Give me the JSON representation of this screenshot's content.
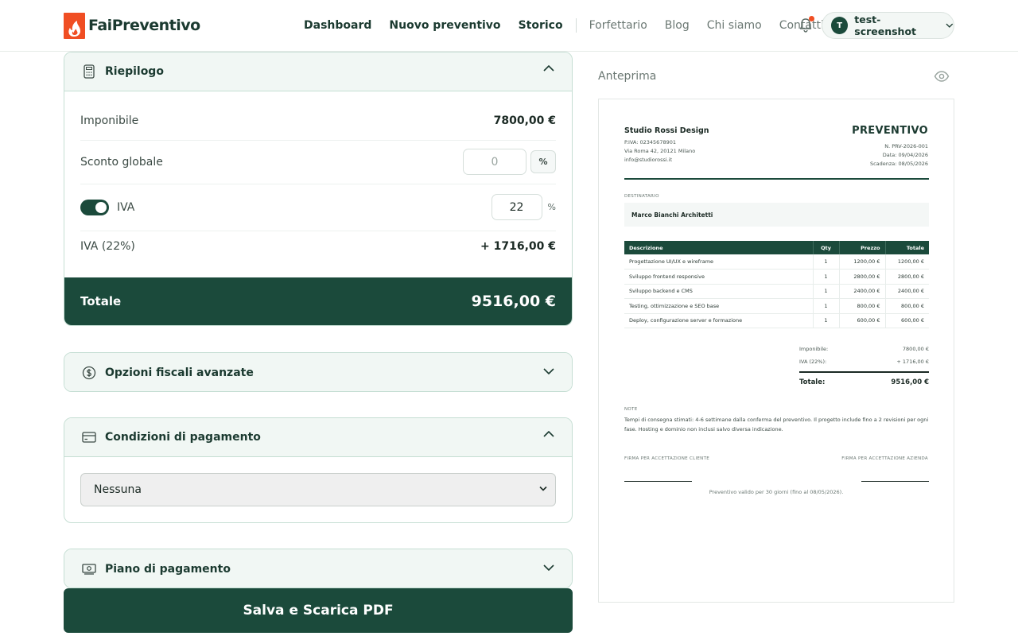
{
  "brand": {
    "name": "FaiPreventivo",
    "accent": "#f04e23",
    "primary": "#1b4a3b"
  },
  "nav": {
    "primary": [
      "Dashboard",
      "Nuovo preventivo",
      "Storico"
    ],
    "secondary": [
      "Forfettario",
      "Blog",
      "Chi siamo",
      "Contatti"
    ]
  },
  "user": {
    "initial": "T",
    "name": "test-screenshot"
  },
  "riepilogo": {
    "title": "Riepilogo",
    "imponibile_label": "Imponibile",
    "imponibile_value": "7800,00 €",
    "sconto_label": "Sconto globale",
    "sconto_placeholder": "0",
    "sconto_unit": "%",
    "iva_label": "IVA",
    "iva_value": "22",
    "iva_unit": "%",
    "iva_amount_label": "IVA (22%)",
    "iva_amount_value": "+ 1716,00 €",
    "totale_label": "Totale",
    "totale_value": "9516,00 €"
  },
  "opzioni_fiscali": {
    "title": "Opzioni fiscali avanzate"
  },
  "condizioni": {
    "title": "Condizioni di pagamento",
    "selected": "Nessuna"
  },
  "piano": {
    "title": "Piano di pagamento"
  },
  "save_button": "Salva e Scarica PDF",
  "preview": {
    "label": "Anteprima",
    "company": "Studio Rossi Design",
    "company_lines": [
      "P.IVA: 02345678901",
      "Via Roma 42, 20121 Milano",
      "info@studiorossi.it"
    ],
    "doc_title": "PREVENTIVO",
    "doc_lines": [
      "N. PRV-2026-001",
      "Data: 09/04/2026",
      "Scadenza: 08/05/2026"
    ],
    "recipient_label": "DESTINATARIO",
    "recipient": "Marco Bianchi Architetti",
    "table_headers": [
      "Descrizione",
      "Qty",
      "Prezzo",
      "Totale"
    ],
    "items": [
      {
        "desc": "Progettazione UI/UX e wireframe",
        "qty": "1",
        "price": "1200,00 €",
        "total": "1200,00 €"
      },
      {
        "desc": "Sviluppo frontend responsive",
        "qty": "1",
        "price": "2800,00 €",
        "total": "2800,00 €"
      },
      {
        "desc": "Sviluppo backend e CMS",
        "qty": "1",
        "price": "2400,00 €",
        "total": "2400,00 €"
      },
      {
        "desc": "Testing, ottimizzazione e SEO base",
        "qty": "1",
        "price": "800,00 €",
        "total": "800,00 €"
      },
      {
        "desc": "Deploy, configurazione server e formazione",
        "qty": "1",
        "price": "600,00 €",
        "total": "600,00 €"
      }
    ],
    "imponibile_label": "Imponibile:",
    "imponibile_value": "7800,00 €",
    "iva_label": "IVA (22%):",
    "iva_value": "+ 1716,00 €",
    "totale_label": "Totale:",
    "totale_value": "9516,00 €",
    "notes_label": "NOTE",
    "notes": "Tempi di consegna stimati: 4-6 settimane dalla conferma del preventivo. Il progetto include fino a 2 revisioni per ogni fase. Hosting e dominio non inclusi salvo diversa indicazione.",
    "sig_client": "FIRMA PER ACCETTAZIONE CLIENTE",
    "sig_company": "FIRMA PER ACCETTAZIONE AZIENDA",
    "validity": "Preventivo valido per 30 giorni (fino al 08/05/2026)."
  }
}
